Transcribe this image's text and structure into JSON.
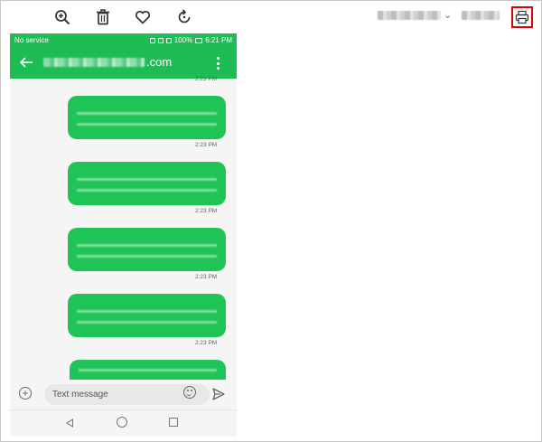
{
  "toolbar": {
    "icons": [
      "zoom-in-icon",
      "trash-icon",
      "heart-icon",
      "rotate-icon"
    ],
    "right_icon": "printer-icon",
    "dropdown_icon": "chevron-down-icon"
  },
  "phone": {
    "status_bar": {
      "carrier": "No service",
      "battery": "100%",
      "time": "6:21 PM"
    },
    "conversation": {
      "contact_suffix": ".com",
      "back_icon": "arrow-left-icon",
      "menu_icon": "kebab-menu-icon"
    },
    "messages": [
      {
        "time": "2:23 PM"
      },
      {
        "time": "2:23 PM"
      },
      {
        "time": "2:23 PM"
      },
      {
        "time": "2:23 PM"
      },
      {
        "time": "2:23 PM"
      },
      {
        "time": ""
      }
    ],
    "composer": {
      "placeholder": "Text message"
    }
  },
  "colors": {
    "accent_green": "#1ec456",
    "header_green": "#1dbd53",
    "highlight_red": "#e00000"
  }
}
